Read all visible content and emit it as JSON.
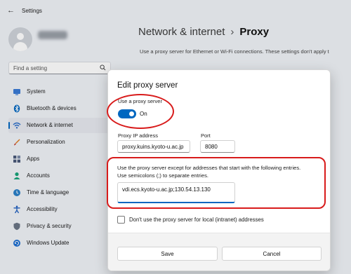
{
  "window": {
    "app_title": "Settings",
    "back_icon": "back-arrow-icon"
  },
  "search": {
    "placeholder": "Find a setting"
  },
  "sidebar": {
    "items": [
      {
        "label": "System",
        "icon": "system-icon",
        "color": "#3a7bd5"
      },
      {
        "label": "Bluetooth & devices",
        "icon": "bluetooth-icon",
        "color": "#0067c0"
      },
      {
        "label": "Network & internet",
        "icon": "wifi-icon",
        "color": "#2f6fc9",
        "active": true
      },
      {
        "label": "Personalization",
        "icon": "brush-icon",
        "color": "#e07a1f"
      },
      {
        "label": "Apps",
        "icon": "apps-icon",
        "color": "#4a5a7a"
      },
      {
        "label": "Accounts",
        "icon": "person-icon",
        "color": "#1aa37a"
      },
      {
        "label": "Time & language",
        "icon": "clock-globe-icon",
        "color": "#2a7fc8"
      },
      {
        "label": "Accessibility",
        "icon": "accessibility-icon",
        "color": "#1f5fbf"
      },
      {
        "label": "Privacy & security",
        "icon": "shield-icon",
        "color": "#6b7686"
      },
      {
        "label": "Windows Update",
        "icon": "update-icon",
        "color": "#1f6fd1"
      }
    ]
  },
  "header": {
    "breadcrumb_parent": "Network & internet",
    "breadcrumb_separator": "›",
    "breadcrumb_current": "Proxy",
    "description": "Use a proxy server for Ethernet or Wi-Fi connections. These settings don't apply t"
  },
  "dialog": {
    "title": "Edit proxy server",
    "use_proxy_label": "Use a proxy server",
    "toggle_state": "On",
    "proxy_ip_label": "Proxy IP address",
    "proxy_ip_value": "proxy.kuins.kyoto-u.ac.jp",
    "port_label": "Port",
    "port_value": "8080",
    "exception_line1": "Use the proxy server except for addresses that start with the following entries.",
    "exception_line2": "Use semicolons (;) to separate entries.",
    "exception_value": "vdi.ecs.kyoto-u.ac.jp;130.54.13.130",
    "local_checkbox_label": "Don't use the proxy server for local (intranet) addresses",
    "save_label": "Save",
    "cancel_label": "Cancel"
  },
  "colors": {
    "accent": "#0067c0",
    "annotation": "#d81b1b"
  }
}
